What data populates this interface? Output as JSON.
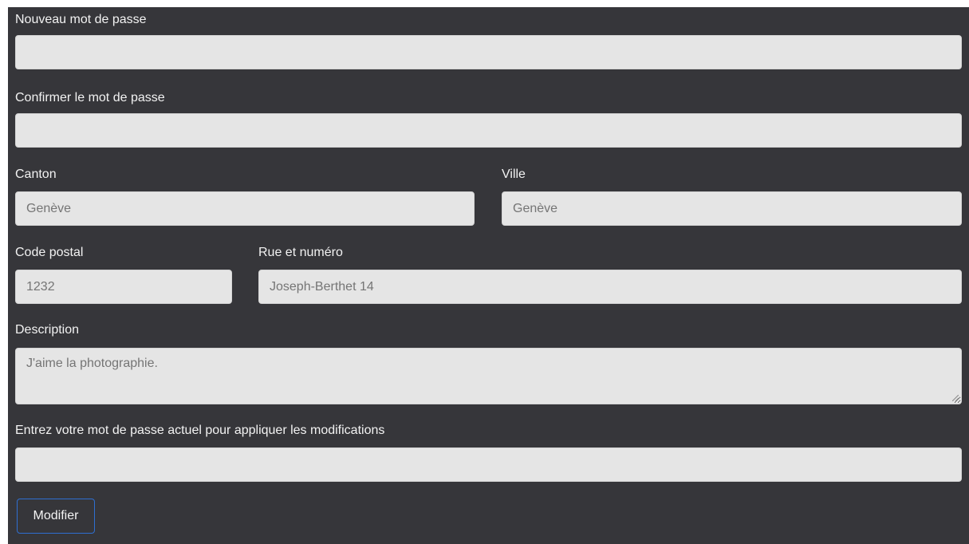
{
  "form": {
    "new_password": {
      "label": "Nouveau mot de passe",
      "value": ""
    },
    "confirm_password": {
      "label": "Confirmer le mot de passe",
      "value": ""
    },
    "canton": {
      "label": "Canton",
      "placeholder": "Genève"
    },
    "city": {
      "label": "Ville",
      "placeholder": "Genève"
    },
    "postal_code": {
      "label": "Code postal",
      "placeholder": "1232"
    },
    "street": {
      "label": "Rue et numéro",
      "placeholder": "Joseph-Berthet 14"
    },
    "description": {
      "label": "Description",
      "placeholder": "J'aime la photographie."
    },
    "current_password": {
      "label": "Entrez votre mot de passe actuel pour appliquer les modifications",
      "value": ""
    },
    "submit_label": "Modifier"
  },
  "colors": {
    "panel_background": "#36363a",
    "field_background": "#e5e5e5",
    "button_border": "#2f6fd1"
  }
}
